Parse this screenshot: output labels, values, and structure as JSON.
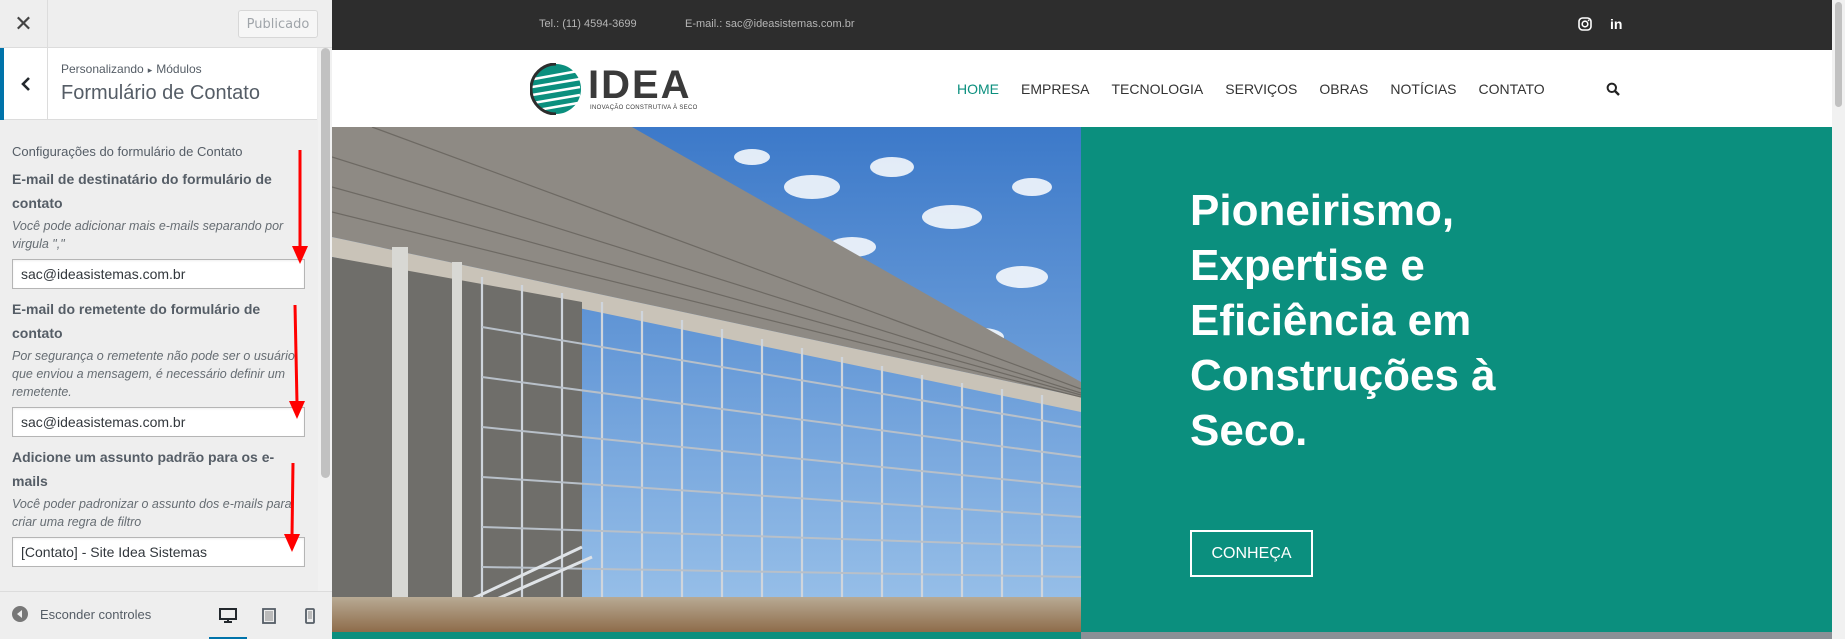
{
  "panel": {
    "close_label": "✕",
    "publish_label": "Publicado",
    "breadcrumb": {
      "part1": "Personalizando",
      "separator": "▸",
      "part2": "Módulos"
    },
    "section_title": "Formulário de Contato",
    "group_label": "Configurações do formulário de Contato",
    "fields": [
      {
        "title": "E-mail de destinatário do formulário de contato",
        "description": "Você pode adicionar mais e-mails separando por virgula \",\"",
        "value": "sac@ideasistemas.com.br"
      },
      {
        "title": "E-mail do remetente do formulário de contato",
        "description": "Por segurança o remetente não pode ser o usuário que enviou a mensagem, é necessário definir um remetente.",
        "value": "sac@ideasistemas.com.br"
      },
      {
        "title": "Adicione um assunto padrão para os e-mails",
        "description": "Você poder padronizar o assunto dos e-mails para criar uma regra de filtro",
        "value": "[Contato] - Site Idea Sistemas"
      }
    ],
    "footer": {
      "hide_controls_label": "Esconder controles",
      "devices": [
        "desktop-icon",
        "tablet-icon",
        "mobile-icon"
      ],
      "active_device": "desktop"
    }
  },
  "site": {
    "topbar": {
      "phone": "Tel.: (11) 4594-3699",
      "email": "E-mail.: sac@ideasistemas.com.br",
      "social": [
        "instagram-icon",
        "linkedin-icon"
      ],
      "linkedin_glyph": "in"
    },
    "logo": {
      "word": "IDEA",
      "tagline": "INOVAÇÃO CONSTRUTIVA À SECO"
    },
    "nav": [
      {
        "label": "HOME",
        "active": true
      },
      {
        "label": "EMPRESA",
        "active": false
      },
      {
        "label": "TECNOLOGIA",
        "active": false
      },
      {
        "label": "SERVIÇOS",
        "active": false
      },
      {
        "label": "OBRAS",
        "active": false
      },
      {
        "label": "NOTÍCIAS",
        "active": false
      },
      {
        "label": "CONTATO",
        "active": false
      }
    ],
    "hero": {
      "title": "Pioneirismo, Expertise e Eficiência em Construções à Seco.",
      "button_label": "CONHEÇA"
    }
  },
  "colors": {
    "accent": "#0073aa",
    "brand_teal": "#0b8f7e",
    "topbar": "#2d2d2d",
    "annotation_arrow": "#ff0000"
  }
}
